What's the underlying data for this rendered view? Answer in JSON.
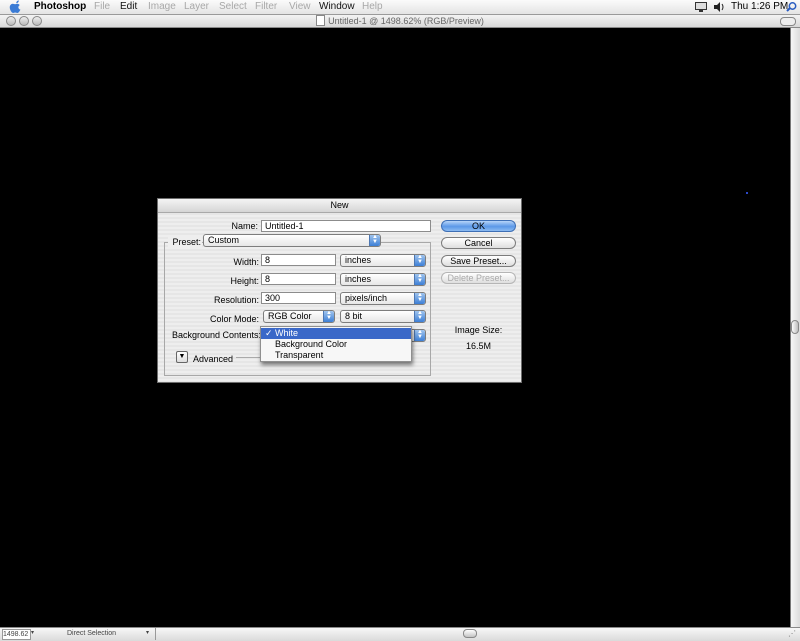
{
  "menubar": {
    "app_name": "Photoshop",
    "items": [
      "File",
      "Edit",
      "Image",
      "Layer",
      "Select",
      "Filter",
      "View",
      "Window",
      "Help"
    ],
    "clock": "Thu 1:26 PM"
  },
  "window": {
    "title": "Untitled-1 @ 1498.62% (RGB/Preview)"
  },
  "statusbar": {
    "zoom": "1498.62",
    "tool": "Direct Selection"
  },
  "dialog": {
    "title": "New",
    "name_label": "Name:",
    "name_value": "Untitled-1",
    "preset_label": "Preset:",
    "preset_value": "Custom",
    "width_label": "Width:",
    "width_value": "8",
    "width_unit": "inches",
    "height_label": "Height:",
    "height_value": "8",
    "height_unit": "inches",
    "resolution_label": "Resolution:",
    "resolution_value": "300",
    "resolution_unit": "pixels/inch",
    "color_mode_label": "Color Mode:",
    "color_mode_value": "RGB Color",
    "bit_depth_value": "8 bit",
    "bg_contents_label": "Background Contents:",
    "advanced_label": "Advanced",
    "buttons": {
      "ok": "OK",
      "cancel": "Cancel",
      "save_preset": "Save Preset...",
      "delete_preset": "Delete Preset..."
    },
    "image_size_label": "Image Size:",
    "image_size_value": "16.5M"
  },
  "bg_menu": {
    "checkmark": "✓",
    "options": [
      "White",
      "Background Color",
      "Transparent"
    ],
    "selected_index": 0
  },
  "colors": {
    "selection_blue": "#3a68c8",
    "default_button_blue": "#5b98e8"
  }
}
